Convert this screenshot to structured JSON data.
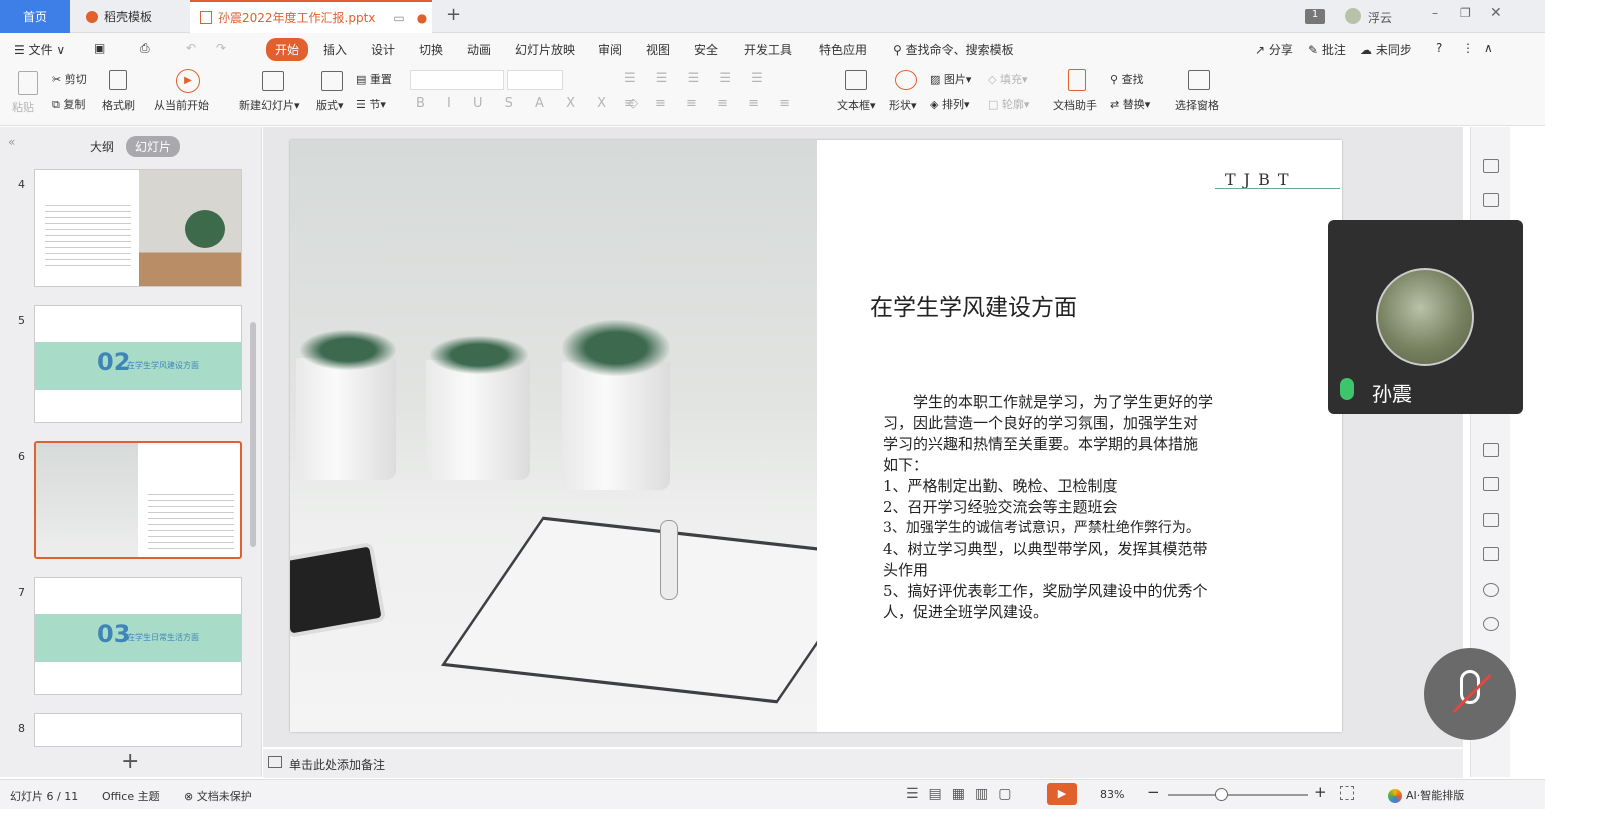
{
  "tabs": {
    "home": "首页",
    "daoke": "稻壳模板",
    "doc": "孙震2022年度工作汇报.pptx"
  },
  "titlebar": {
    "user": "浮云",
    "count": "1"
  },
  "menu": {
    "file": "文件",
    "items": [
      "开始",
      "插入",
      "设计",
      "切换",
      "动画",
      "幻灯片放映",
      "审阅",
      "视图",
      "安全",
      "开发工具",
      "特色应用"
    ],
    "search": "查找命令、搜索模板",
    "share": "分享",
    "comment": "批注",
    "sync": "未同步"
  },
  "ribbon": {
    "paste": "粘贴",
    "cut": "剪切",
    "copy": "复制",
    "format_brush": "格式刷",
    "from_current": "从当前开始",
    "new_slide": "新建幻灯片",
    "layout": "版式",
    "reset": "重置",
    "section": "节",
    "textbox": "文本框",
    "shape": "形状",
    "picture": "图片",
    "fill": "填充",
    "arrange": "排列",
    "outline": "轮廓",
    "doc_helper": "文档助手",
    "find": "查找",
    "replace": "替换",
    "select_pane": "选择窗格"
  },
  "panel": {
    "outline_tab": "大纲",
    "slides_tab": "幻灯片",
    "slide_numbers": [
      "4",
      "5",
      "6",
      "7",
      "8"
    ],
    "thumb5_num": "02",
    "thumb5_title": "在学生学风建设方面",
    "thumb7_num": "03",
    "thumb7_title": "在学生日常生活方面",
    "add_icon": "plus-icon"
  },
  "slide": {
    "logo": "TJBT",
    "title": "在学生学风建设方面",
    "body": [
      "　　学生的本职工作就是学习，为了学生更好的学",
      "习，因此营造一个良好的学习氛围，加强学生对",
      "学习的兴趣和热情至关重要。本学期的具体措施",
      "如下：",
      "1、严格制定出勤、晚检、卫检制度",
      "2、召开学习经验交流会等主题班会",
      "3、加强学生的诚信考试意识，严禁杜绝作弊行为。",
      "4、树立学习典型，以典型带学风，发挥其模范带",
      "头作用",
      "5、搞好评优表彰工作，奖励学风建设中的优秀个",
      "人，促进全班学风建设。"
    ]
  },
  "notes_placeholder": "单击此处添加备注",
  "status": {
    "slide_count": "幻灯片 6 / 11",
    "theme": "Office 主题",
    "protect": "文档未保护",
    "zoom": "83%",
    "ai": "AI·智能排版"
  },
  "video": {
    "name": "孙震"
  },
  "colors": {
    "accent": "#e0602e",
    "home_tab": "#3d7fe6",
    "band": "#a9dcc8",
    "band_text": "#3e85b8"
  }
}
